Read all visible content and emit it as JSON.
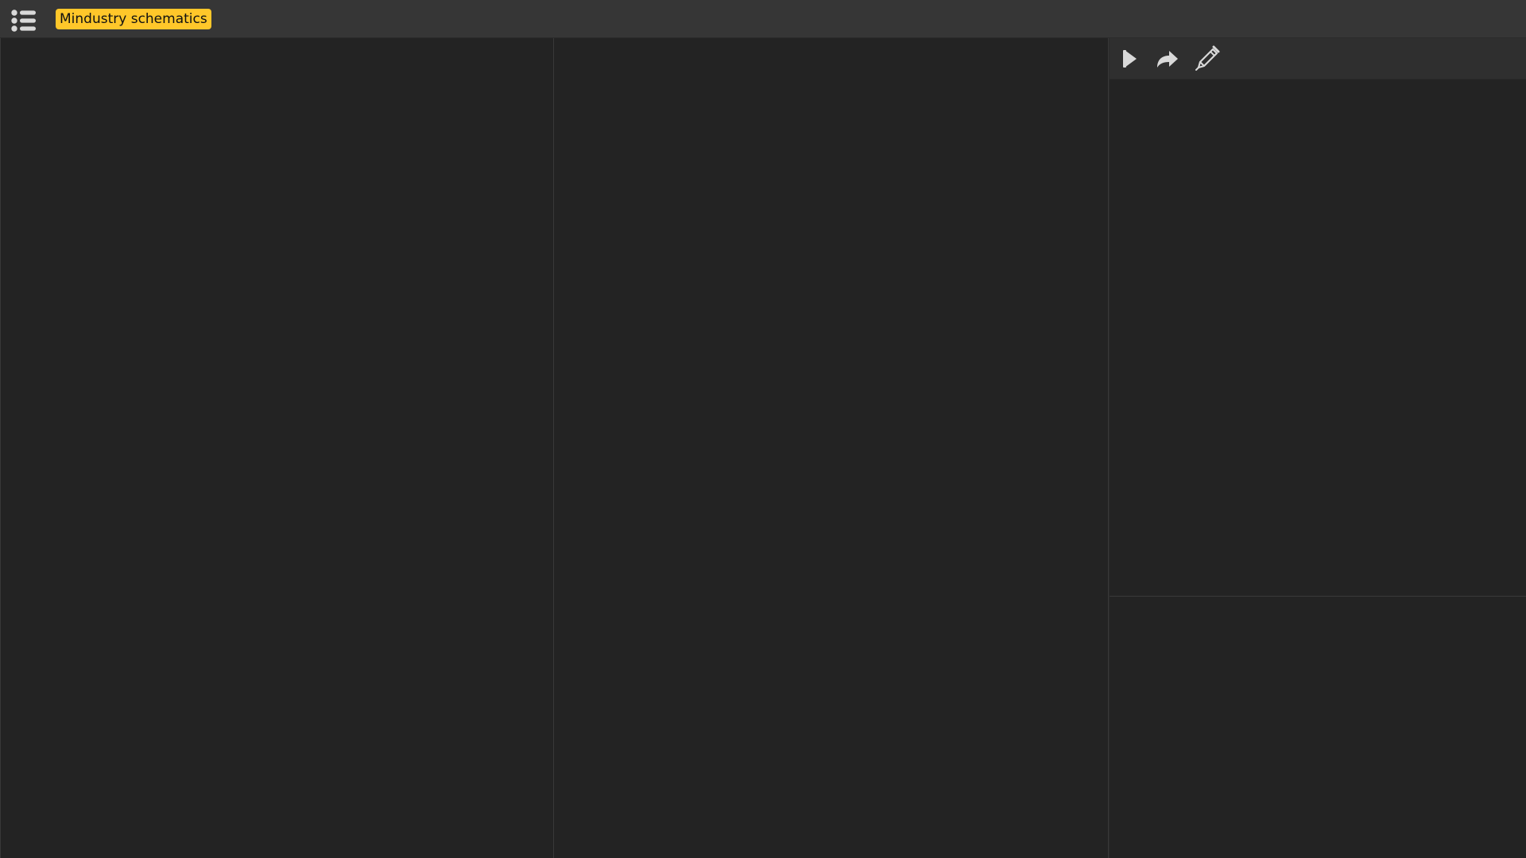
{
  "header": {
    "menu_icon": "list-icon",
    "title": "Mindustry schematics",
    "title_bg": "#ffc72a",
    "title_fg": "#111111"
  },
  "colors": {
    "topbar": "#363636",
    "panel_bg": "#232323",
    "divider": "#383838",
    "icon": "#d9d9d9"
  },
  "toolbar": {
    "buttons": [
      {
        "icon": "play-icon"
      },
      {
        "icon": "redo-arrow-icon"
      },
      {
        "icon": "pencil-icon"
      }
    ]
  }
}
